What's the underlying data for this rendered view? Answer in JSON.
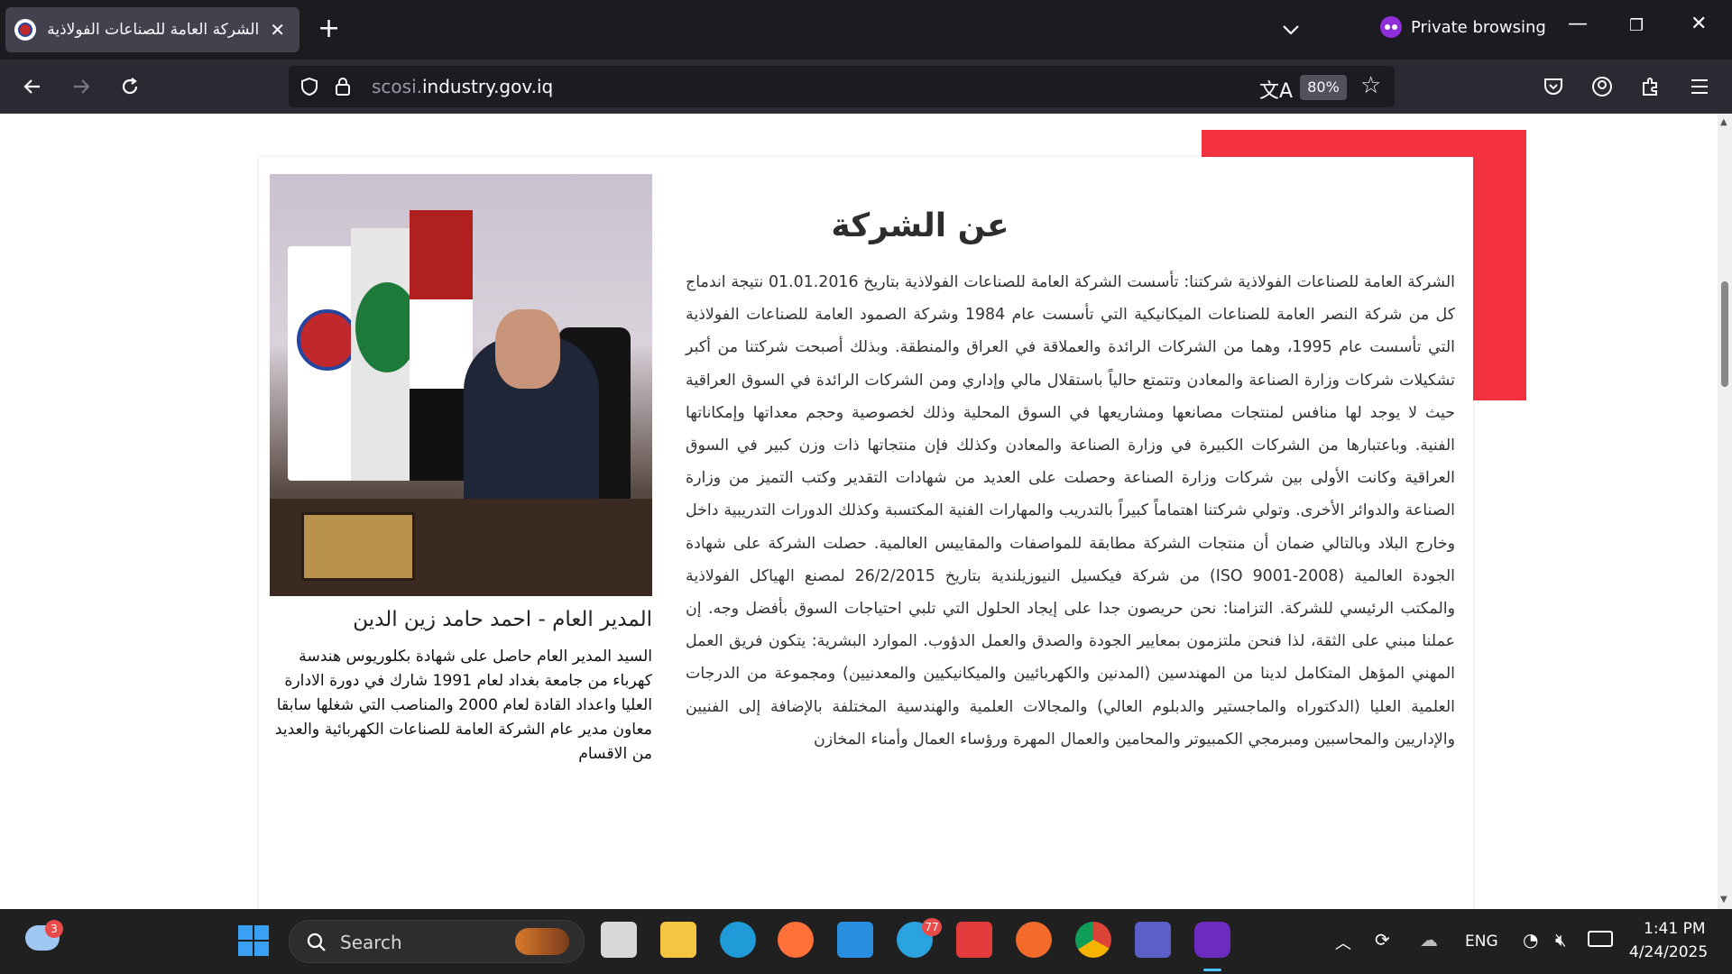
{
  "browser": {
    "tab_title": "الشركة العامة للصناعات الفولاذية",
    "private_label": "Private browsing",
    "url_prefix": "scosi.",
    "url_domain": "industry.gov.iq",
    "zoom": "80%"
  },
  "page": {
    "manager": {
      "name": "المدير العام - احمد حامد زين الدين",
      "bio": "السيد المدير العام حاصل على شهادة بكلوريوس هندسة كهرباء من جامعة بغداد لعام 1991 شارك في دورة الادارة العليا واعداد القادة لعام 2000 والمناصب التي شغلها سابقا معاون مدير عام الشركة العامة للصناعات الكهربائية والعديد من الاقسام"
    },
    "about": {
      "title": "عن الشركة",
      "body": "الشركة العامة للصناعات الفولاذية شركتنا: تأسست الشركة العامة للصناعات الفولاذية بتاريخ 01.01.2016 نتيجة اندماج كل من شركة النصر العامة للصناعات الميكانيكية التي تأسست عام 1984 وشركة الصمود العامة للصناعات الفولاذية التي تأسست عام 1995، وهما من الشركات الرائدة والعملاقة في العراق والمنطقة. وبذلك أصبحت شركتنا من أكبر تشكيلات شركات وزارة الصناعة والمعادن وتتمتع حالياً باستقلال مالي وإداري ومن الشركات الرائدة في السوق العراقية حيث لا يوجد لها منافس لمنتجات مصانعها ومشاريعها في السوق المحلية وذلك لخصوصية وحجم معداتها وإمكاناتها الفنية. وباعتبارها من الشركات الكبيرة في وزارة الصناعة والمعادن وكذلك فإن منتجاتها ذات وزن كبير في السوق العراقية وكانت الأولى بين شركات وزارة الصناعة وحصلت على العديد من شهادات التقدير وكتب التميز من وزارة الصناعة والدوائر الأخرى. وتولي شركتنا اهتماماً كبيراً بالتدريب والمهارات الفنية المكتسبة وكذلك الدورات التدريبية داخل وخارج البلاد وبالتالي ضمان أن منتجات الشركة مطابقة للمواصفات والمقاييس العالمية. حصلت الشركة على شهادة الجودة العالمية (ISO 9001-2008) من شركة فيكسيل النيوزيلندية بتاريخ 26/2/2015 لمصنع الهياكل الفولاذية والمكتب الرئيسي للشركة. التزامنا: نحن حريصون جدا على إيجاد الحلول التي تلبي احتياجات السوق بأفضل وجه. إن عملنا مبني على الثقة، لذا فنحن ملتزمون بمعايير الجودة والصدق والعمل الدؤوب. الموارد البشرية: يتكون فريق العمل المهني المؤهل المتكامل لدينا من المهندسين (المدنين والكهربائيين والميكانيكيين والمعدنيين) ومجموعة من الدرجات العلمية العليا (الدكتوراه والماجستير والدبلوم العالي) والمجالات العلمية والهندسية المختلفة بالإضافة إلى الفنيين والإداريين والمحاسبين ومبرمجي الكمبيوتر والمحامين والعمال المهرة ورؤساء العمال وأمناء المخازن"
    }
  },
  "taskbar": {
    "search_label": "Search",
    "weather_badge": "3",
    "telegram_badge": "77",
    "lang": "ENG",
    "time": "1:41 PM",
    "date": "4/24/2025"
  },
  "colors": {
    "accent_red": "#f3313f",
    "tab_bg": "#42414d",
    "private_purple": "#8f2fdb"
  }
}
